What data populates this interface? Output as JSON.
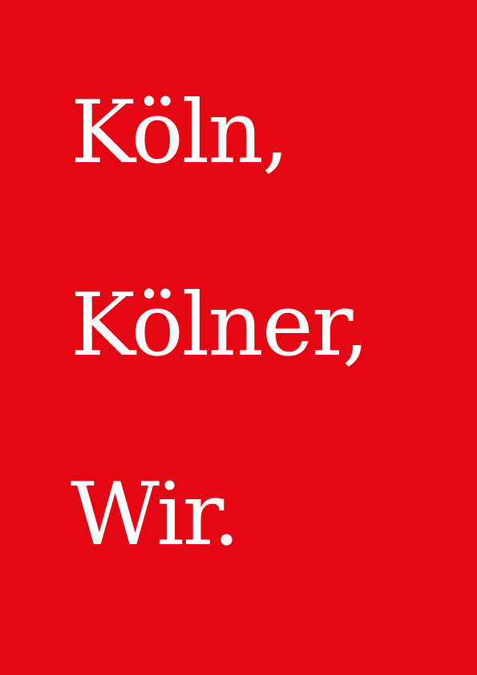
{
  "poster": {
    "background_color": "#e30613",
    "text_color": "#ffffff",
    "lines": [
      "Köln,",
      "Kölner,",
      "Wir."
    ]
  }
}
